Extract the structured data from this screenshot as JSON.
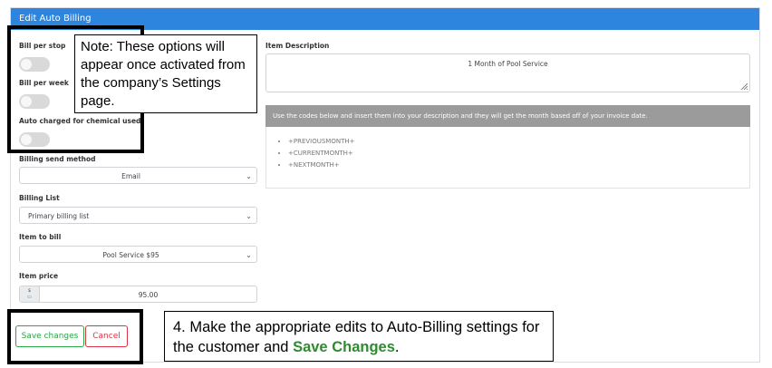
{
  "header": {
    "title": "Edit Auto Billing"
  },
  "toggles": {
    "bill_per_stop": "Bill per stop",
    "bill_per_week": "Bill per week",
    "auto_charged": "Auto charged for chemical used"
  },
  "billing_send_method": {
    "label": "Billing send method",
    "value": "Email"
  },
  "billing_list": {
    "label": "Billing List",
    "value": "Primary billing list"
  },
  "item_to_bill": {
    "label": "Item to bill",
    "value": "Pool Service $95"
  },
  "item_price": {
    "label": "Item price",
    "prefix": "$",
    "value": "95.00"
  },
  "item_description": {
    "label": "Item Description",
    "value": "1 Month of Pool Service"
  },
  "codes_info": {
    "text": "Use the codes below and insert them into your description and they will get the month based off of your invoice date.",
    "codes": [
      "+PREVIOUSMONTH+",
      "+CURRENTMONTH+",
      "+NEXTMONTH+"
    ]
  },
  "buttons": {
    "save": "Save changes",
    "cancel": "Cancel"
  },
  "annotations": {
    "note": "Note:  These options will appear once activated from the company’s Settings page.",
    "step_text": "4. Make the appropriate edits to Auto-Billing settings for the customer and ",
    "step_highlight": "Save Changes",
    "step_end": "."
  }
}
